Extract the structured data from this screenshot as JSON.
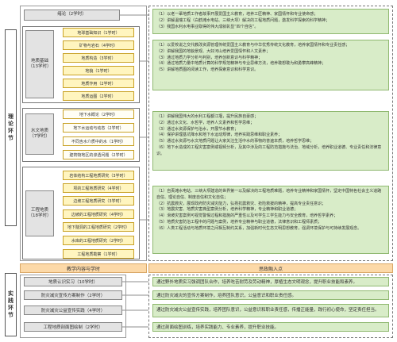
{
  "sections": {
    "theory": "理论环节",
    "practice": "实践环节"
  },
  "intro": "绪论（2学时）",
  "intro_goals": "（1）以老一辈地质工作者故事开展爱国主义教育，培养工匠精神、家国情怀和专业使命感；\n（2）讲解温瑞工程（白鹤滩水电站、三峡大坝）解决的工程地质问题，激发科学探索的科学精神；\n（3）我国水利水电事业取得的伟大成就彰显“四个自信”。",
  "groups": [
    {
      "name": "地质基础\n（13学时）",
      "items": [
        "地球基础知识（1学时）",
        "矿物与岩石（4学时）",
        "地质构造（3学时）",
        "地貌（1学时）",
        "地质作用（2学时）",
        "地质运图（2学时）"
      ],
      "goals": "（1）以爱校说之交代教改资源管理传统爱国主义教育与中华优秀传统文化教育，培养家国情怀和专业责任感；\n（2）讲解我国的地貌景观、大好河山培养爱国情怀和人文素养；\n（3）通过地质力学分析与判别，培养创新意识与科学精神；\n（4）通过地质力量中地质计算的科学规范精神与专业思维方法，培养敢想敢为和勇攀高峰精神；\n（5）讲解地质图的阅读工作，培养探索意识和科学意识。"
    },
    {
      "name": "水文地质\n（7学时）",
      "items": [
        "地下水概论（2学时）",
        "地下水运动与动态（2学时）",
        "不同含水介质中的水（1学时）",
        "建筑物地区的渗透问题（2学时）"
      ],
      "goals": "（1）讲解我国伟大的水利工程都江堰，提升民族自豪感；\n（2）通过水文化、水哲学，培养人文素养和哲学思维；\n（3）通过水资源保护与治水，开展节水教育；\n（4）保护讲理基坑降水和地下水运动规律，培养实践思维和职业素养；\n（5）通过水资源与水文地质问题让大家关注生活中水的事物的普遍本质，培养哲学思维；\n（6）地下水造成的工程灾害案例或视频分析，及其中涉及的工程防范措施与法治、地域分析，培养职业道德、专业责任和法律意识。"
    },
    {
      "name": "工程地质\n（18学时）",
      "items": [
        "岩体结构工程地质研究（3学时）",
        "坝的工程地质研究（4学时）",
        "边坡工程地质研究（3学时）",
        "边坡的工程地质研究（4学时）",
        "地下隧洞的工程地质研究（2学时）",
        "水库的工程地质研究（2学时）",
        "工程地质勘察（1学时）"
      ],
      "goals": "（1）自贡滩水电站、三峡大坝建造的世界第一以及解决的工程地质难题，培养专业精神和家国情怀，坚定中国特色社会主义道路自信、理论自信、制度自信和文化自信；\n（2）抗震救灾，展现政府防灾减灾能力，弘扬抗震救灾、抢险救援的精神，提高专业责任意识；\n（3）地震灾害、地质灾害典型案例分析，培养科学精神，专业精神和职业道德；\n（4）滑坡灾害案例可视觉警惕过程和措施的严重性以及可学生工学生能力与安全教育，培养哲学素养；\n（5）地质灾害防治工程中的问题与案例，培养专业精神与职业道德，法律意识和工程师素质；\n（6）人类工程活动与地质环境之间相互制约关系，加强新时代生态文明思想教育，强调环境保护与可持续发展观念。"
    }
  ],
  "header": {
    "left": "教学内容与学时",
    "right": "思政融入点"
  },
  "practice_items": [
    {
      "label": "地质认识实习（10学时）",
      "goal": "通过野外地质实习强调团队合作，培养吃苦耐劳及劳动精神，厚植生态文明观念，提升职业技能和素养。"
    },
    {
      "label": "防灾减灾宣传方案制作（2学时）",
      "goal": "通过防灾减灾的宣传方案制作，培养团队意识，公益意识和职业责任感。"
    },
    {
      "label": "防灾减灾公益宣传实践（4学时）",
      "goal": "通过防灾减灾公益宣传实践，培养团队意识，公益意识和职业责任感，传播正能量，践行初心使命，坚定责任担当。"
    },
    {
      "label": "工程地质剖面图绘制（2学时）",
      "goal": "通过剖面绘图训练，培养实践能力、专业素养，提升职业技能。"
    }
  ]
}
